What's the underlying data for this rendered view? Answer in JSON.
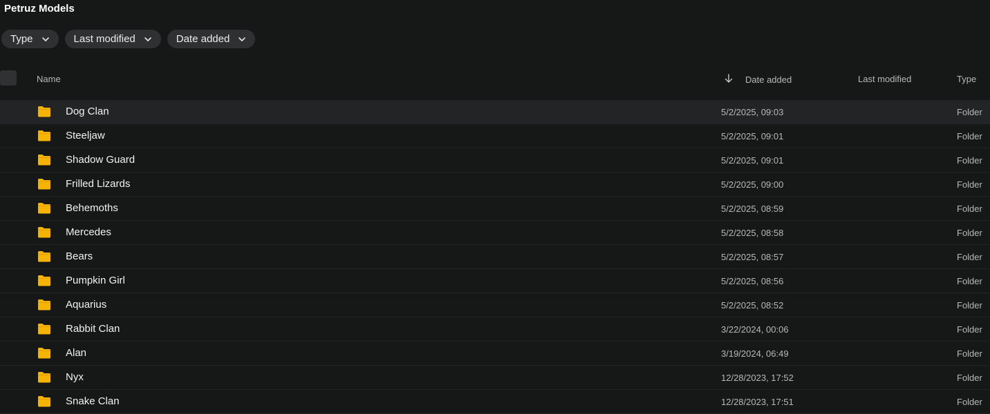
{
  "title": "Petruz Models",
  "filters": [
    {
      "label": "Type"
    },
    {
      "label": "Last modified"
    },
    {
      "label": "Date added"
    }
  ],
  "columns": {
    "name": "Name",
    "date_added": "Date added",
    "last_modified": "Last modified",
    "type": "Type",
    "sort_column": "date_added",
    "sort_direction": "descending"
  },
  "icons": {
    "folder": "folder-icon",
    "chevron": "chevron-down-icon",
    "sort": "arrow-down-icon",
    "folder_color": "#f5b400"
  },
  "rows": [
    {
      "name": "Dog Clan",
      "date_added": "5/2/2025, 09:03",
      "type": "Folder"
    },
    {
      "name": "Steeljaw",
      "date_added": "5/2/2025, 09:01",
      "type": "Folder"
    },
    {
      "name": "Shadow Guard",
      "date_added": "5/2/2025, 09:01",
      "type": "Folder"
    },
    {
      "name": "Frilled Lizards",
      "date_added": "5/2/2025, 09:00",
      "type": "Folder"
    },
    {
      "name": "Behemoths",
      "date_added": "5/2/2025, 08:59",
      "type": "Folder"
    },
    {
      "name": "Mercedes",
      "date_added": "5/2/2025, 08:58",
      "type": "Folder"
    },
    {
      "name": "Bears",
      "date_added": "5/2/2025, 08:57",
      "type": "Folder"
    },
    {
      "name": "Pumpkin Girl",
      "date_added": "5/2/2025, 08:56",
      "type": "Folder"
    },
    {
      "name": "Aquarius",
      "date_added": "5/2/2025, 08:52",
      "type": "Folder"
    },
    {
      "name": "Rabbit Clan",
      "date_added": "3/22/2024, 00:06",
      "type": "Folder"
    },
    {
      "name": "Alan",
      "date_added": "3/19/2024, 06:49",
      "type": "Folder"
    },
    {
      "name": "Nyx",
      "date_added": "12/28/2023, 17:52",
      "type": "Folder"
    },
    {
      "name": "Snake Clan",
      "date_added": "12/28/2023, 17:51",
      "type": "Folder"
    }
  ]
}
